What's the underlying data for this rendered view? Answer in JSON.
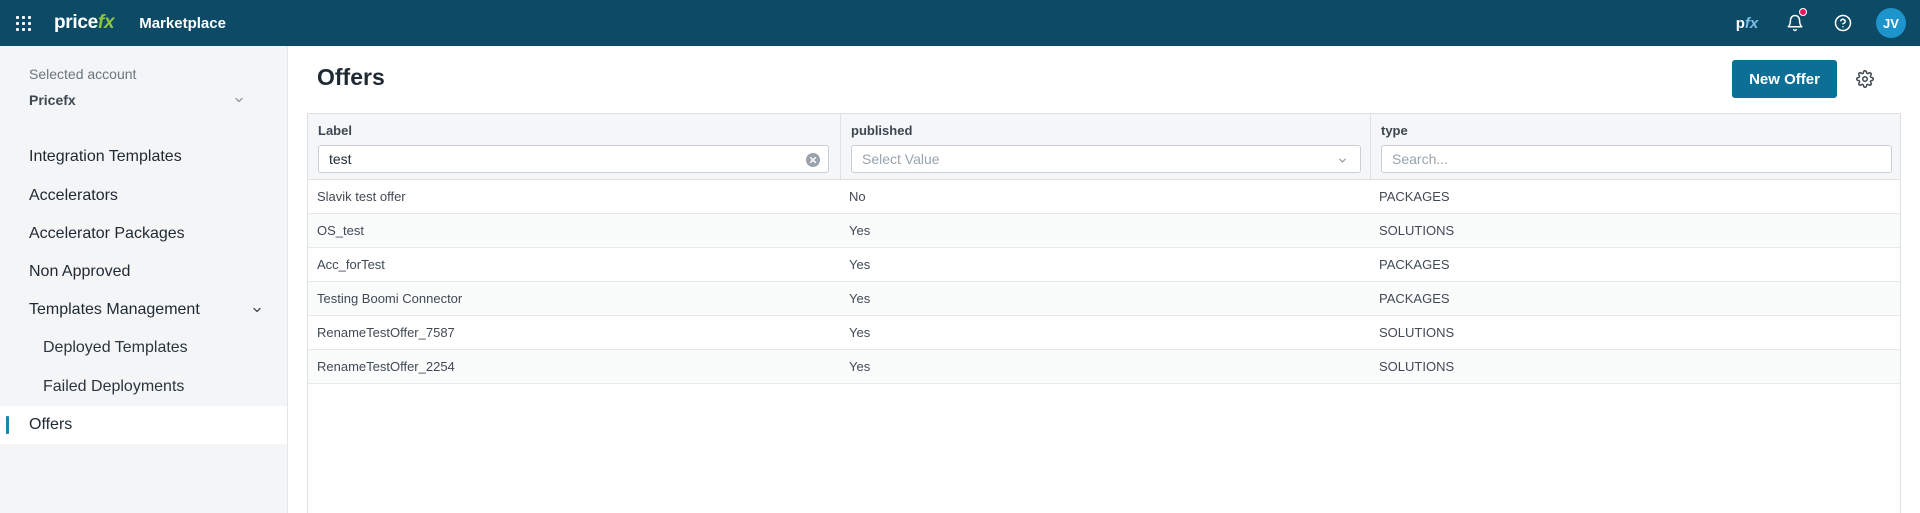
{
  "topbar": {
    "logo_part1": "price",
    "logo_part2": "fx",
    "app_title": "Marketplace",
    "pfx_mark_p": "p",
    "pfx_mark_fx": "fx",
    "avatar_initials": "JV",
    "brand_color": "#0d4a66",
    "icons": [
      "apps-grid-icon",
      "pfx-icon",
      "bell-icon",
      "help-icon"
    ]
  },
  "sidebar": {
    "account_label": "Selected account",
    "account_value": "Pricefx",
    "items": [
      {
        "label": "Integration Templates"
      },
      {
        "label": "Accelerators"
      },
      {
        "label": "Accelerator Packages"
      },
      {
        "label": "Non Approved"
      },
      {
        "label": "Templates Management",
        "expanded": true
      },
      {
        "label": "Deployed Templates",
        "sub": true
      },
      {
        "label": "Failed Deployments",
        "sub": true
      },
      {
        "label": "Offers",
        "active": true
      }
    ]
  },
  "main": {
    "title": "Offers",
    "new_offer_label": "New Offer",
    "accent_color": "#0e6f96",
    "grid": {
      "columns": [
        {
          "title": "Label",
          "filter_value": "test"
        },
        {
          "title": "published",
          "filter_placeholder": "Select Value"
        },
        {
          "title": "type",
          "filter_placeholder": "Search..."
        }
      ],
      "rows": [
        {
          "label": "Slavik test offer",
          "published": "No",
          "type": "PACKAGES"
        },
        {
          "label": "OS_test",
          "published": "Yes",
          "type": "SOLUTIONS"
        },
        {
          "label": "Acc_forTest",
          "published": "Yes",
          "type": "PACKAGES"
        },
        {
          "label": "Testing Boomi Connector",
          "published": "Yes",
          "type": "PACKAGES"
        },
        {
          "label": "RenameTestOffer_7587",
          "published": "Yes",
          "type": "SOLUTIONS"
        },
        {
          "label": "RenameTestOffer_2254",
          "published": "Yes",
          "type": "SOLUTIONS"
        }
      ]
    }
  }
}
